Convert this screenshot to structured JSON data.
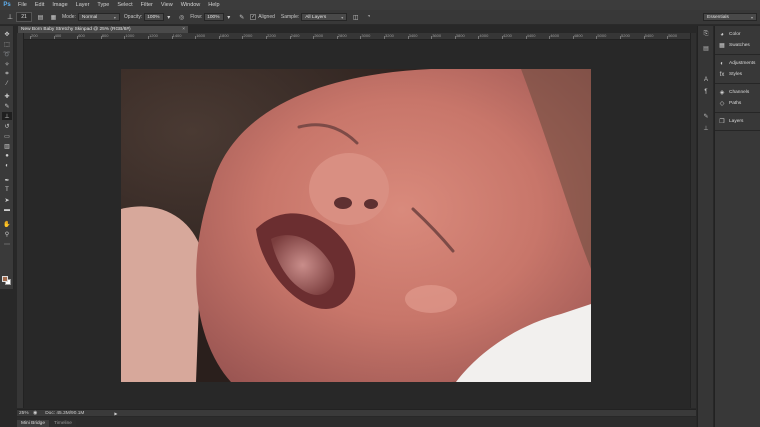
{
  "app": {
    "logo": "Ps"
  },
  "menu": [
    "File",
    "Edit",
    "Image",
    "Layer",
    "Type",
    "Select",
    "Filter",
    "View",
    "Window",
    "Help"
  ],
  "options": {
    "brush_size": "21",
    "mode_label": "Mode:",
    "mode_value": "Normal",
    "opacity_label": "Opacity:",
    "opacity_value": "100%",
    "flow_label": "Flow:",
    "flow_value": "100%",
    "aligned_label": "Aligned",
    "sample_label": "Sample:",
    "sample_value": "All Layers",
    "workspace": "Essentials"
  },
  "document": {
    "tab_title": "New Born Baby Stretchy Skinpad @ 25% (RGB/8#)",
    "close_glyph": "×",
    "ruler_ticks": [
      "200",
      "400",
      "600",
      "800",
      "1000",
      "1200",
      "1400",
      "1600",
      "1800",
      "2000",
      "2200",
      "2400",
      "2600",
      "2800",
      "3000",
      "3200",
      "3400",
      "3600",
      "3800",
      "4000",
      "4200",
      "4400",
      "4600",
      "4800",
      "5000",
      "5200",
      "5400",
      "5600"
    ]
  },
  "status": {
    "zoom": "25%",
    "doc_info": "Doc: 45.3M/90.1M"
  },
  "bottom_tabs": [
    "Mini Bridge",
    "Timeline"
  ],
  "panels": {
    "groups": [
      [
        {
          "icon": "color-icon",
          "label": "Color"
        },
        {
          "icon": "swatches-icon",
          "label": "Swatches"
        }
      ],
      [
        {
          "icon": "adjustments-icon",
          "label": "Adjustments"
        },
        {
          "icon": "styles-icon",
          "label": "Styles"
        }
      ],
      [
        {
          "icon": "channels-icon",
          "label": "Channels"
        },
        {
          "icon": "paths-icon",
          "label": "Paths"
        }
      ],
      [
        {
          "icon": "layers-icon",
          "label": "Layers"
        }
      ]
    ]
  },
  "colors": {
    "foreground": "#a26a4c",
    "background": "#ffffff",
    "chrome": "#3c3c3c",
    "canvas_bg": "#282828"
  },
  "tools": [
    "move-tool-icon",
    "marquee-tool-icon",
    "lasso-tool-icon",
    "quick-select-tool-icon",
    "crop-tool-icon",
    "eyedropper-tool-icon",
    "spot-healing-tool-icon",
    "brush-tool-icon",
    "clone-stamp-tool-icon",
    "history-brush-tool-icon",
    "eraser-tool-icon",
    "gradient-tool-icon",
    "blur-tool-icon",
    "dodge-tool-icon",
    "pen-tool-icon",
    "type-tool-icon",
    "path-select-tool-icon",
    "shape-tool-icon",
    "hand-tool-icon",
    "zoom-tool-icon"
  ]
}
